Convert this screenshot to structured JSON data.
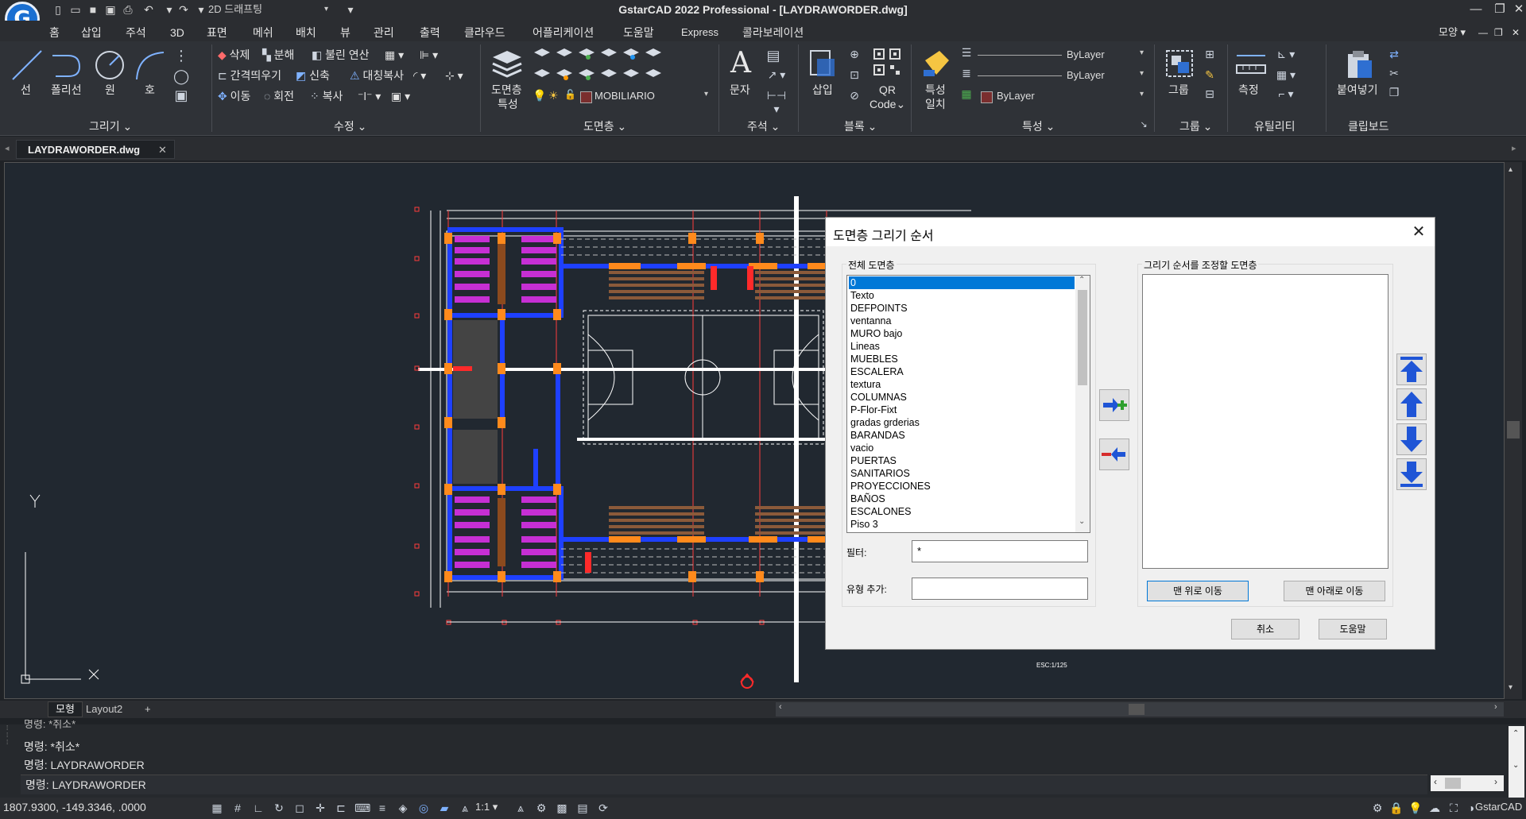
{
  "app": {
    "title": "GstarCAD 2022 Professional - [LAYDRAWORDER.dwg]",
    "logo_letter": "G",
    "workspace": "2D 드래프팅",
    "right_label": "모양"
  },
  "menu": [
    "홈",
    "삽입",
    "주석",
    "3D",
    "표면",
    "메쉬",
    "배치",
    "뷰",
    "관리",
    "출력",
    "클라우드",
    "어플리케이션",
    "도움말",
    "Express",
    "콜라보레이션"
  ],
  "ribbon": {
    "draw": {
      "title": "그리기",
      "line": "선",
      "polyline": "폴리선",
      "circle": "원",
      "arc": "호"
    },
    "modify": {
      "title": "수정",
      "erase": "삭제",
      "explode": "분해",
      "boolean": "불린 연산",
      "offset": "간격띄우기",
      "stretch": "신축",
      "mirror": "대칭복사",
      "move": "이동",
      "rotate": "회전",
      "copy": "복사"
    },
    "layers": {
      "title": "도면층",
      "props": "도면층\n특성",
      "current_layer": "MOBILIARIO",
      "props_line1": "도면층",
      "props_line2": "특성"
    },
    "annotation": {
      "title": "주석",
      "text": "문자"
    },
    "block": {
      "title": "블록",
      "insert": "삽입",
      "qr_line1": "QR",
      "qr_line2": "Code"
    },
    "properties": {
      "title": "특성",
      "match_line1": "특성",
      "match_line2": "일치",
      "linetype": "ByLayer",
      "lineweight": "ByLayer",
      "color": "ByLayer"
    },
    "groups": {
      "title": "그룹",
      "group": "그룹"
    },
    "utilities": {
      "title": "유틸리티",
      "measure": "측정"
    },
    "clipboard": {
      "title": "클립보드",
      "paste": "붙여넣기"
    }
  },
  "document_tab": "LAYDRAWORDER.dwg",
  "drawing": {
    "scale_note": "ESC:1/125"
  },
  "dialog": {
    "title": "도면층 그리기 순서",
    "all_layers_label": "전체 도면층",
    "order_layers_label": "그리기 순서를 조정할 도면층",
    "layers": [
      "0",
      "Texto",
      "DEFPOINTS",
      "ventanna",
      "MURO bajo",
      "Lineas",
      "MUEBLES",
      "ESCALERA",
      "textura",
      "COLUMNAS",
      "P-Flor-Fixt",
      "gradas grderias",
      "BARANDAS",
      "vacio",
      "PUERTAS",
      "SANITARIOS",
      "PROYECCIONES",
      "BAÑOS",
      "ESCALONES",
      "Piso 3"
    ],
    "filter_label": "필터:",
    "filter_value": "*",
    "add_type_label": "유형 추가:",
    "add_type_value": "",
    "move_top_btn": "맨 위로 이동",
    "move_bottom_btn": "맨 아래로 이동",
    "cancel_btn": "취소",
    "help_btn": "도움말"
  },
  "layout_tabs": [
    "모형",
    "Layout2",
    "+"
  ],
  "command_lines": [
    "명령: *취소*",
    "명령: *취소*",
    "명령: LAYDRAWORDER",
    "명령: LAYDRAWORDER"
  ],
  "status": {
    "coords": "1807.9300, -149.3346, .0000",
    "scale": "1:1",
    "brand": "GstarCAD"
  }
}
